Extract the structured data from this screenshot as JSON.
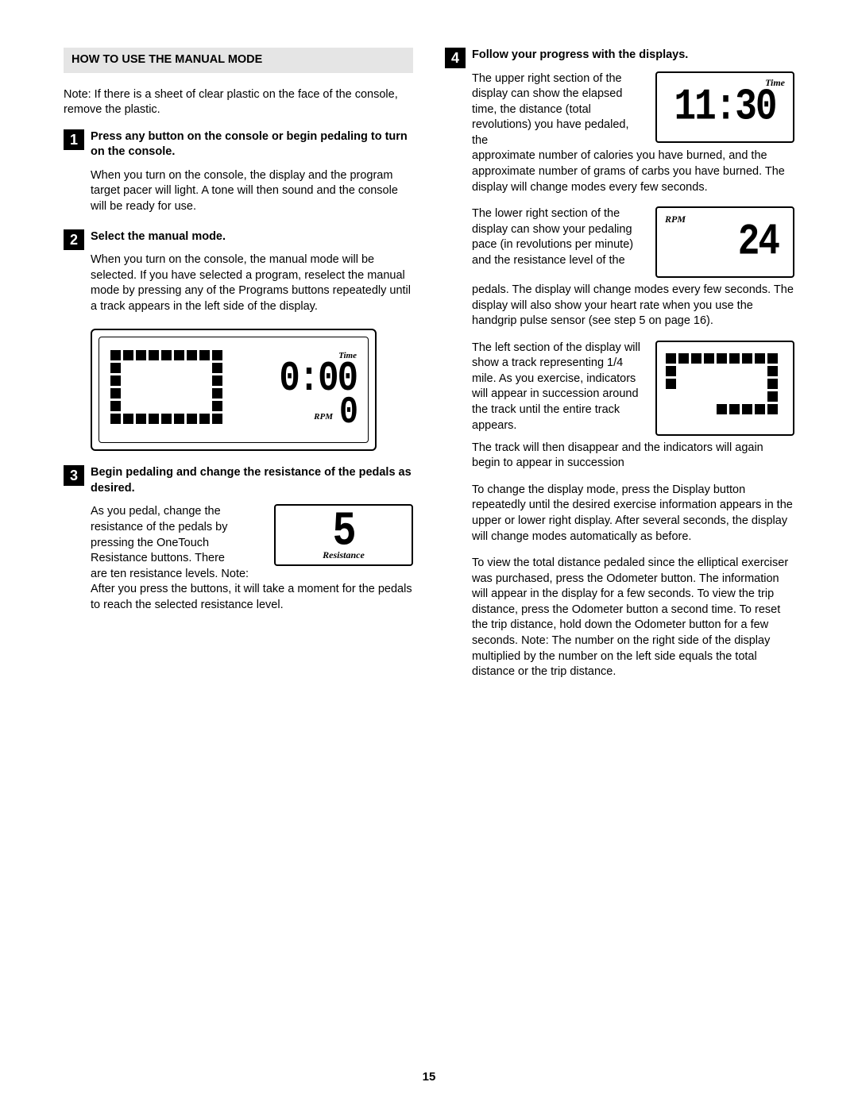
{
  "page_number": "15",
  "left": {
    "section_header": "HOW TO USE THE MANUAL MODE",
    "intro_note": "Note: If there is a sheet of clear plastic on the face of the console, remove the plastic.",
    "steps": {
      "s1": {
        "num": "1",
        "title": "Press any button on the console or begin pedaling to turn on the console.",
        "body": "When you turn on the console, the display and the program target pacer will light. A tone will then sound and the console will be ready for use."
      },
      "s2": {
        "num": "2",
        "title": "Select the manual mode.",
        "body": "When you turn on the console, the manual mode will be selected. If you have selected a program, reselect the manual mode by pressing any of the Programs buttons repeatedly until a track appears in the left side of the display."
      },
      "s3": {
        "num": "3",
        "title": "Begin pedaling and change the resistance of the pedals as desired.",
        "body_a": "As you pedal, change the resistance of the pedals by pressing the OneTouch Resistance buttons. There",
        "body_b": "are ten resistance levels. Note: After you press the buttons, it will take a moment for the pedals to reach the selected resistance level."
      }
    },
    "console": {
      "label_time": "Time",
      "label_rpm": "RPM",
      "time_value": "0:00",
      "rpm_value": "0"
    },
    "resistance_fig": {
      "label": "Resistance",
      "value": "5"
    }
  },
  "right": {
    "s4": {
      "num": "4",
      "title": "Follow your progress with the displays.",
      "p1a": "The upper right section of the display can show the elapsed time, the distance (total revolutions) you have pedaled, the",
      "p1b": "approximate number of calories you have burned, and the approximate number of grams of carbs you have burned. The display will change modes every few seconds.",
      "time_fig": {
        "label": "Time",
        "value": "11:30"
      },
      "p2a": "The lower right section of the display can show your pedaling pace (in revolutions per minute) and the resistance level of the",
      "p2b": "pedals. The display will change modes every few seconds. The display will also show your heart rate when you use the handgrip pulse sensor (see step 5 on page 16).",
      "rpm_fig": {
        "label": "RPM",
        "value": "24"
      },
      "p3a": "The left section of the display will show a track representing 1/4 mile. As you exercise, indicators will appear in succession around the track until the entire track appears.",
      "p3b": "The track will then disappear and the indicators will again begin to appear in succession",
      "p4": "To change the display mode, press the Display button repeatedly until the desired exercise information appears in the upper or lower right display. After several seconds, the display will change modes automatically as before.",
      "p5": "To view the total distance pedaled since the elliptical exerciser was purchased, press the Odometer button. The information will appear in the display for a few seconds. To view the trip distance, press the Odometer button a second time. To reset the trip distance, hold down the Odometer button for a few seconds. Note: The number on the right side of the display multiplied by the number on the left side equals the total distance or the trip distance."
    }
  }
}
